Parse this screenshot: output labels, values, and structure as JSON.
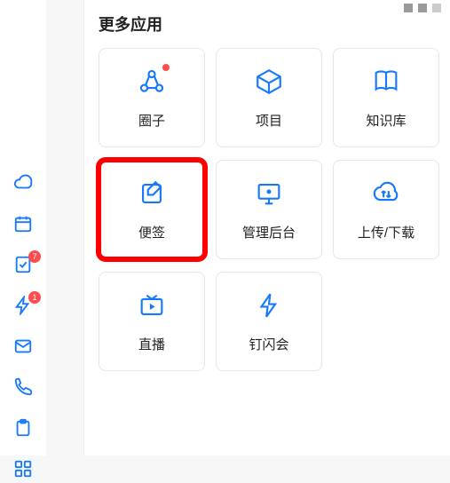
{
  "colors": {
    "accent": "#1677ff",
    "danger": "#ff4d4f"
  },
  "sidebar": {
    "items": [
      {
        "name": "cloud",
        "icon": "cloud-icon",
        "badge": null
      },
      {
        "name": "calendar",
        "icon": "calendar-icon",
        "badge": null
      },
      {
        "name": "docs",
        "icon": "doc-check-icon",
        "badge": "7"
      },
      {
        "name": "flash",
        "icon": "bolt-icon",
        "badge": "1"
      },
      {
        "name": "mail",
        "icon": "mail-icon",
        "badge": null
      },
      {
        "name": "phone",
        "icon": "phone-icon",
        "badge": null
      },
      {
        "name": "clip",
        "icon": "clip-icon",
        "badge": null
      },
      {
        "name": "more",
        "icon": "more-icon",
        "badge": null
      }
    ]
  },
  "panel": {
    "title": "更多应用",
    "tiles": [
      {
        "label": "圈子",
        "icon": "circle-icon",
        "dot": true
      },
      {
        "label": "项目",
        "icon": "project-icon",
        "dot": false
      },
      {
        "label": "知识库",
        "icon": "book-icon",
        "dot": false
      },
      {
        "label": "便签",
        "icon": "note-icon",
        "dot": false,
        "highlight": true
      },
      {
        "label": "管理后台",
        "icon": "monitor-icon",
        "dot": false
      },
      {
        "label": "上传/下载",
        "icon": "updown-icon",
        "dot": false
      },
      {
        "label": "直播",
        "icon": "live-icon",
        "dot": false
      },
      {
        "label": "钉闪会",
        "icon": "spark-icon",
        "dot": false
      }
    ]
  }
}
